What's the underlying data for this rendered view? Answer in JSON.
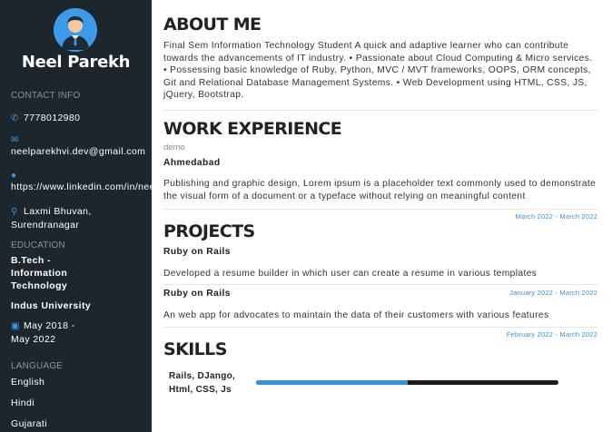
{
  "sidebar": {
    "name": "Neel Parekh",
    "contact_heading": "CONTACT INFO",
    "phone": "7778012980",
    "email": "neelparekhvi.dev@gmail.com",
    "linkedin": "https://www.linkedin.com/in/neelparekh",
    "address": "Laxmi Bhuvan, Surendranagar",
    "education_heading": "EDUCATION",
    "degree": "B.Tech - Information Technology",
    "university": "Indus University",
    "edu_dates": "May 2018 - May 2022",
    "language_heading": "LANGUAGE",
    "languages": [
      "English",
      "Hindi",
      "Gujarati"
    ],
    "icons": {
      "phone": "phone-icon",
      "email": "envelope-icon",
      "linkedin": "globe-icon",
      "address": "map-marker-icon",
      "dates": "calendar-icon"
    }
  },
  "about": {
    "heading": "ABOUT ME",
    "text": "Final Sem Information Technology Student A quick and adaptive learner who can contribute towards the advancements of IT industry. • Passionate about Cloud Computing & Micro services. • Possessing basic knowledge of Ruby, Python, MVC / MVT frameworks, OOPS, ORM concepts, Git and Relational Database Management Systems. • Web Development using HTML, CSS, JS, jQuery, Bootstrap."
  },
  "work": {
    "heading": "WORK EXPERIENCE",
    "company": "demo",
    "location": "Ahmedabad",
    "description": "Publishing and graphic design, Lorem ipsum is a placeholder text commonly used to demonstrate the visual form of a document or a typeface without relying on meaningful content",
    "dates": "March 2022 - March 2022"
  },
  "projects": {
    "heading": "PROJECTS",
    "items": [
      {
        "title": "Ruby on Rails",
        "description": "Developed a resume builder in which user can create a resume in various templates",
        "dates": "January 2022 - March 2022"
      },
      {
        "title": "Ruby on Rails",
        "description": "An web app for advocates to maintain the data of their customers with various features",
        "dates": "February 2022 - March 2022"
      }
    ]
  },
  "skills": {
    "heading": "SKILLS",
    "items": [
      {
        "label": "Rails, DJango, Html, CSS, Js",
        "level": 0.5
      }
    ]
  },
  "colors": {
    "sidebar_bg": "#1d252d",
    "accent": "#3d8ed8",
    "bar_track": "#1c1c1c"
  }
}
